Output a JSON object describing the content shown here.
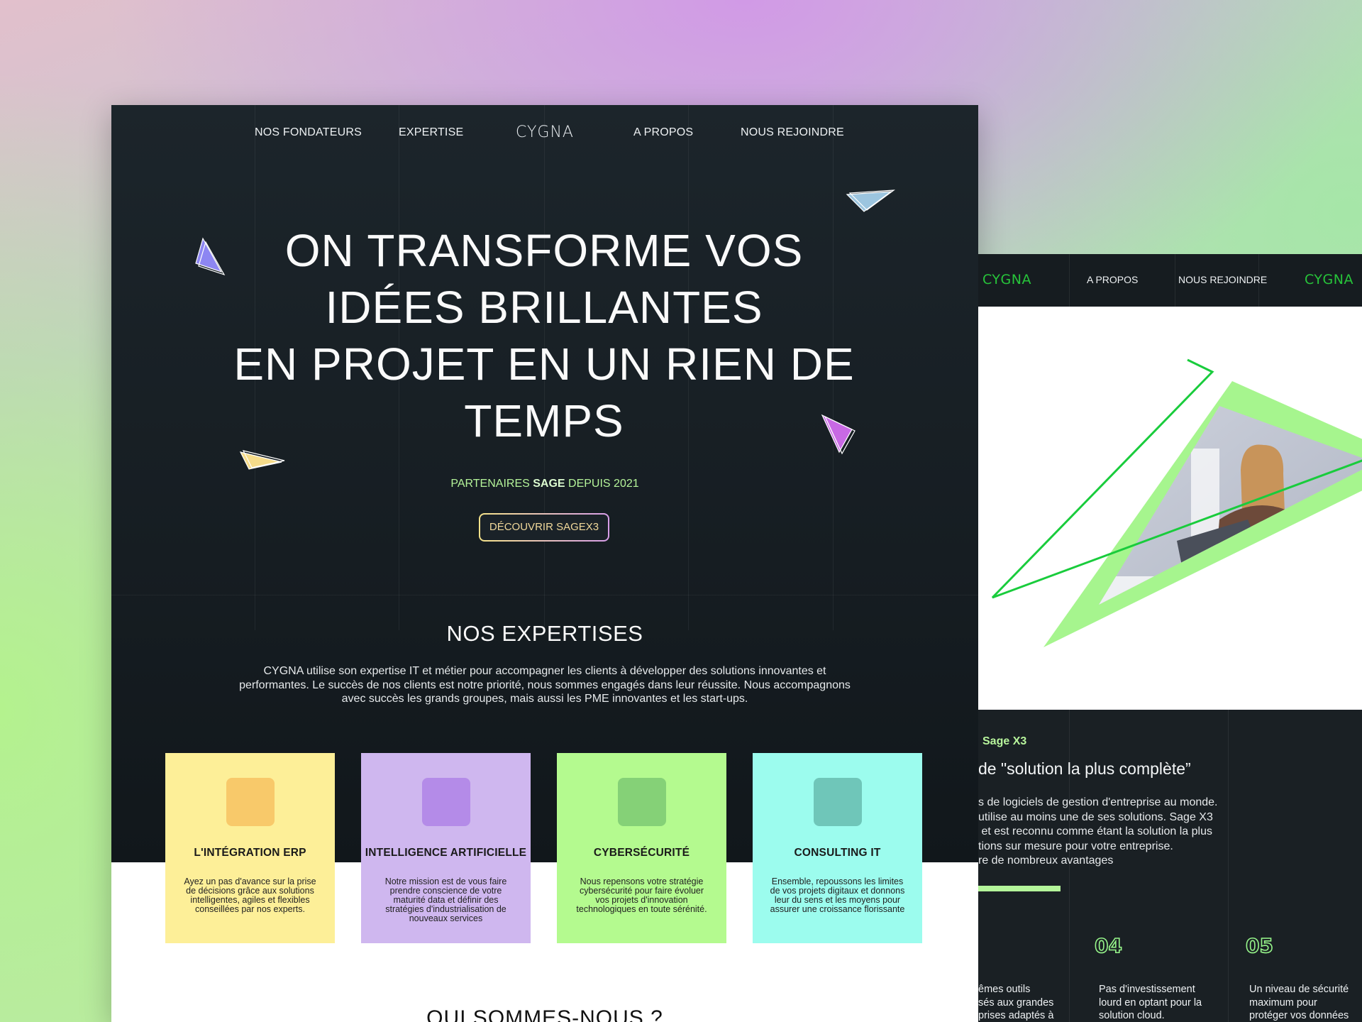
{
  "main": {
    "nav": {
      "item1": "NOS FONDATEURS",
      "item2": "EXPERTISE",
      "logo": "CYGNA",
      "item3": "A PROPOS",
      "item4": "NOUS REJOINDRE"
    },
    "hero": {
      "line1": "ON TRANSFORME VOS",
      "line2": "IDÉES BRILLANTES",
      "line3": "EN PROJET EN UN RIEN DE",
      "line4": "TEMPS",
      "partner_pre": "PARTENAIRES ",
      "partner_bold": "SAGE",
      "partner_post": " DEPUIS 2021",
      "cta": "DÉCOUVRIR SAGEX3"
    },
    "expertises": {
      "title": "NOS EXPERTISES",
      "text": "CYGNA utilise son expertise IT et métier pour accompagner les clients à développer des solutions innovantes et performantes. Le succès de nos clients est notre priorité, nous sommes engagés dans leur réussite. Nous accompagnons avec succès les grands groupes, mais aussi les PME innovantes et les start-ups."
    },
    "cards": [
      {
        "title": "L'INTÉGRATION ERP",
        "desc": "Ayez un pas d'avance sur la prise de décisions grâce aux solutions intelligentes, agiles et flexibles conseillées par nos experts.",
        "bg": "#fdef98",
        "square": "#f8c96a"
      },
      {
        "title": "INTELLIGENCE ARTIFICIELLE",
        "desc": "Notre mission est de vous faire prendre conscience de votre maturité data et définir des stratégies d'industrialisation de nouveaux services",
        "bg": "#cfb7ef",
        "square": "#b48be8"
      },
      {
        "title": "CYBERSÉCURITÉ",
        "desc": "Nous repensons votre stratégie cybersécurité pour faire évoluer vos projets d'innovation technologiques en toute sérénité.",
        "bg": "#b4fa8f",
        "square": "#85d177"
      },
      {
        "title": "CONSULTING IT",
        "desc": "Ensemble, repoussons les limites de vos projets digitaux et donnons leur du sens et les moyens pour assurer une croissance florissante",
        "bg": "#9cfcee",
        "square": "#6fc6b9"
      }
    ],
    "bottom_title": "QUI SOMMES-NOUS ?"
  },
  "second": {
    "nav": {
      "logo_left": "CYGNA",
      "item1": "A PROPOS",
      "item2": "NOUS REJOINDRE",
      "logo_right": "CYGNA"
    },
    "kicker": "Sage X3",
    "quote": "de \"solution la plus complète”",
    "text": "s de logiciels de gestion d'entreprise au monde.\nutilise au moins une de ses solutions. Sage X3\n et est reconnu comme étant la solution la plus\ntions sur mesure pour votre entreprise.\nre de nombreux avantages",
    "features": [
      {
        "num": "",
        "text": "êmes outils\nsés aux grandes\nprises adaptés à"
      },
      {
        "num": "04",
        "text": "Pas d'investissement\nlourd en optant pour la\nsolution cloud."
      },
      {
        "num": "05",
        "text": "Un niveau de sécurité\nmaximum pour\nprotéger vos données"
      }
    ]
  },
  "colors": {
    "dark_bg": "#1a2228",
    "accent_green": "#b5f49a",
    "logo_green": "#27c43a"
  }
}
